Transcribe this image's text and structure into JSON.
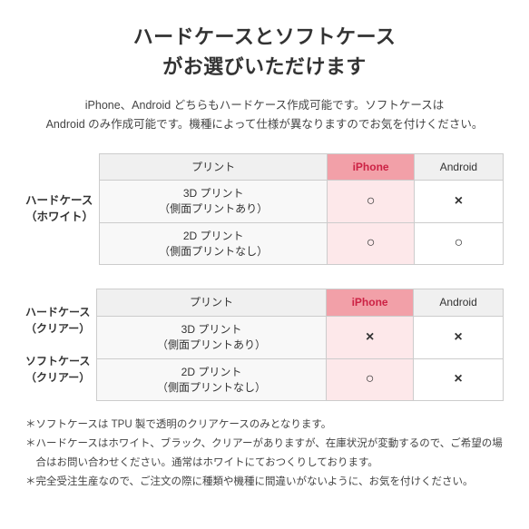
{
  "title": {
    "line1": "ハードケースとソフトケース",
    "line2": "がお選びいただけます"
  },
  "subtitle": "iPhone、Android どちらもハードケース作成可能です。ソフトケースは\nAndroid のみ作成可能です。機種によって仕様が異なりますのでお気を付けください。",
  "table1": {
    "row_header_line1": "ハードケース",
    "row_header_line2": "（ホワイト）",
    "col_print": "プリント",
    "col_iphone": "iPhone",
    "col_android": "Android",
    "rows": [
      {
        "label_line1": "3D プリント",
        "label_line2": "（側面プリントあり）",
        "iphone": "○",
        "android": "×"
      },
      {
        "label_line1": "2D プリント",
        "label_line2": "（側面プリントなし）",
        "iphone": "○",
        "android": "○"
      }
    ]
  },
  "table2": {
    "row_header_line1a": "ハードケース",
    "row_header_line2a": "（クリアー）",
    "row_header_line1b": "ソフトケース",
    "row_header_line2b": "（クリアー）",
    "col_print": "プリント",
    "col_iphone": "iPhone",
    "col_android": "Android",
    "rows": [
      {
        "label_line1": "3D プリント",
        "label_line2": "（側面プリントあり）",
        "iphone": "×",
        "android": "×"
      },
      {
        "label_line1": "2D プリント",
        "label_line2": "（側面プリントなし）",
        "iphone": "○",
        "android": "×"
      }
    ]
  },
  "notes": [
    "＊ソフトケースは TPU 製で透明のクリアケースのみとなります。",
    "＊ハードケースはホワイト、ブラック、クリアーがありますが、在庫状況が変動するので、ご希望の場合はお問い合わせください。通常はホワイトにておつくりしております。",
    "＊完全受注生産なので、ご注文の際に種類や機種に間違いがないように、お気を付けください。"
  ]
}
